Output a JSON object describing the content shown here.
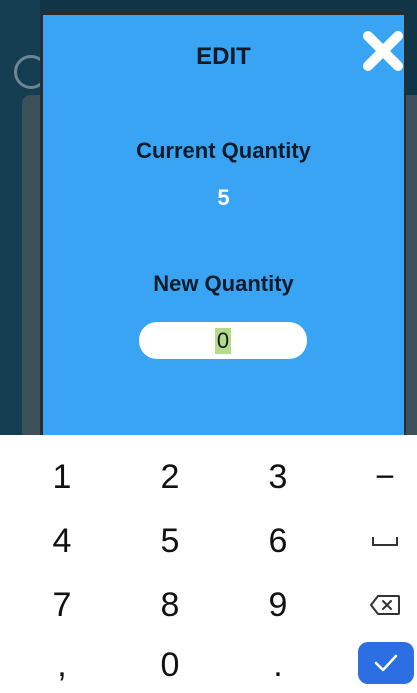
{
  "dialog": {
    "title": "EDIT",
    "current_label": "Current Quantity",
    "current_value": "5",
    "new_label": "New Quantity",
    "new_value": "0"
  },
  "keyboard": {
    "keys": [
      "1",
      "2",
      "3",
      "4",
      "5",
      "6",
      "7",
      "8",
      "9",
      ",",
      "0",
      "."
    ],
    "side_keys": [
      "−",
      "space-icon",
      "backspace-icon",
      "check-icon"
    ]
  },
  "colors": {
    "dialog_bg": "#39a4f4",
    "done_key": "#2c6fe3",
    "input_selection": "#b6d98a"
  }
}
